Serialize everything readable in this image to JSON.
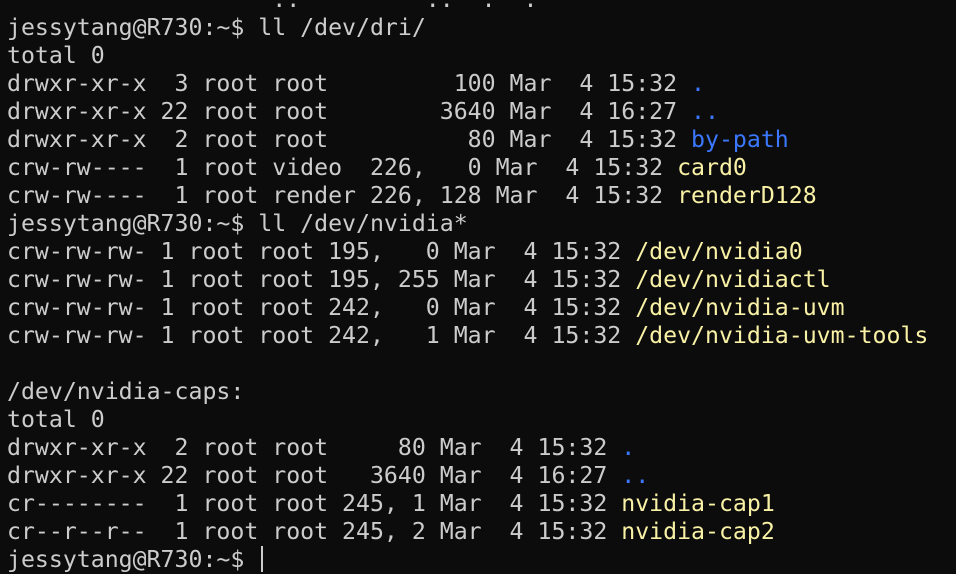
{
  "terminal": {
    "lines": [
      {
        "type": "text",
        "text": "                   ..   ˜  ‘  ..  .  ."
      },
      {
        "type": "text",
        "text": "jessytang@R730:~$ ll /dev/dri/"
      },
      {
        "type": "text",
        "text": "total 0"
      },
      {
        "type": "entry",
        "meta": "drwxr-xr-x  3 root root         100 Mar  4 15:32 ",
        "name": ".",
        "style": "dir"
      },
      {
        "type": "entry",
        "meta": "drwxr-xr-x 22 root root        3640 Mar  4 16:27 ",
        "name": "..",
        "style": "dir"
      },
      {
        "type": "entry",
        "meta": "drwxr-xr-x  2 root root          80 Mar  4 15:32 ",
        "name": "by-path",
        "style": "dir"
      },
      {
        "type": "entry",
        "meta": "crw-rw----  1 root video  226,   0 Mar  4 15:32 ",
        "name": "card0",
        "style": "dev"
      },
      {
        "type": "entry",
        "meta": "crw-rw----  1 root render 226, 128 Mar  4 15:32 ",
        "name": "renderD128",
        "style": "dev"
      },
      {
        "type": "text",
        "text": "jessytang@R730:~$ ll /dev/nvidia*"
      },
      {
        "type": "entry",
        "meta": "crw-rw-rw- 1 root root 195,   0 Mar  4 15:32 ",
        "name": "/dev/nvidia0",
        "style": "dev"
      },
      {
        "type": "entry",
        "meta": "crw-rw-rw- 1 root root 195, 255 Mar  4 15:32 ",
        "name": "/dev/nvidiactl",
        "style": "dev"
      },
      {
        "type": "entry",
        "meta": "crw-rw-rw- 1 root root 242,   0 Mar  4 15:32 ",
        "name": "/dev/nvidia-uvm",
        "style": "dev"
      },
      {
        "type": "entry",
        "meta": "crw-rw-rw- 1 root root 242,   1 Mar  4 15:32 ",
        "name": "/dev/nvidia-uvm-tools",
        "style": "dev"
      },
      {
        "type": "text",
        "text": ""
      },
      {
        "type": "text",
        "text": "/dev/nvidia-caps:"
      },
      {
        "type": "text",
        "text": "total 0"
      },
      {
        "type": "entry",
        "meta": "drwxr-xr-x  2 root root     80 Mar  4 15:32 ",
        "name": ".",
        "style": "dir"
      },
      {
        "type": "entry",
        "meta": "drwxr-xr-x 22 root root   3640 Mar  4 16:27 ",
        "name": "..",
        "style": "dir"
      },
      {
        "type": "entry",
        "meta": "cr--------  1 root root 245, 1 Mar  4 15:32 ",
        "name": "nvidia-cap1",
        "style": "dev"
      },
      {
        "type": "entry",
        "meta": "cr--r--r--  1 root root 245, 2 Mar  4 15:32 ",
        "name": "nvidia-cap2",
        "style": "dev"
      },
      {
        "type": "prompt",
        "text": "jessytang@R730:~$ "
      }
    ]
  }
}
